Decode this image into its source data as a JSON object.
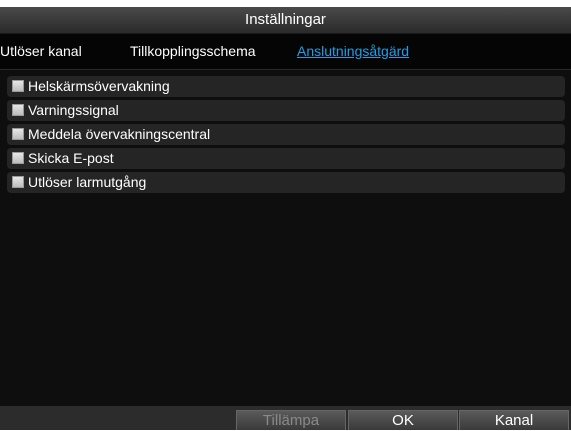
{
  "window": {
    "title": "Inställningar"
  },
  "tabs": [
    {
      "label": "Utlöser kanal",
      "active": false
    },
    {
      "label": "Tillkopplingsschema",
      "active": false
    },
    {
      "label": "Anslutningsåtgärd",
      "active": true
    }
  ],
  "actions": [
    {
      "label": "Helskärmsövervakning",
      "checked": false
    },
    {
      "label": "Varningssignal",
      "checked": false
    },
    {
      "label": "Meddela övervakningscentral",
      "checked": false
    },
    {
      "label": "Skicka E-post",
      "checked": false
    },
    {
      "label": "Utlöser larmutgång",
      "checked": false
    }
  ],
  "footer": {
    "apply_label": "Tillämpa",
    "apply_enabled": false,
    "ok_label": "OK",
    "kanal_label": "Kanal"
  },
  "colors": {
    "background": "#0e0e0e",
    "accent": "#1da0ea",
    "row": "#252525",
    "text": "#ffffff",
    "disabled_text": "#8a8a8a"
  }
}
